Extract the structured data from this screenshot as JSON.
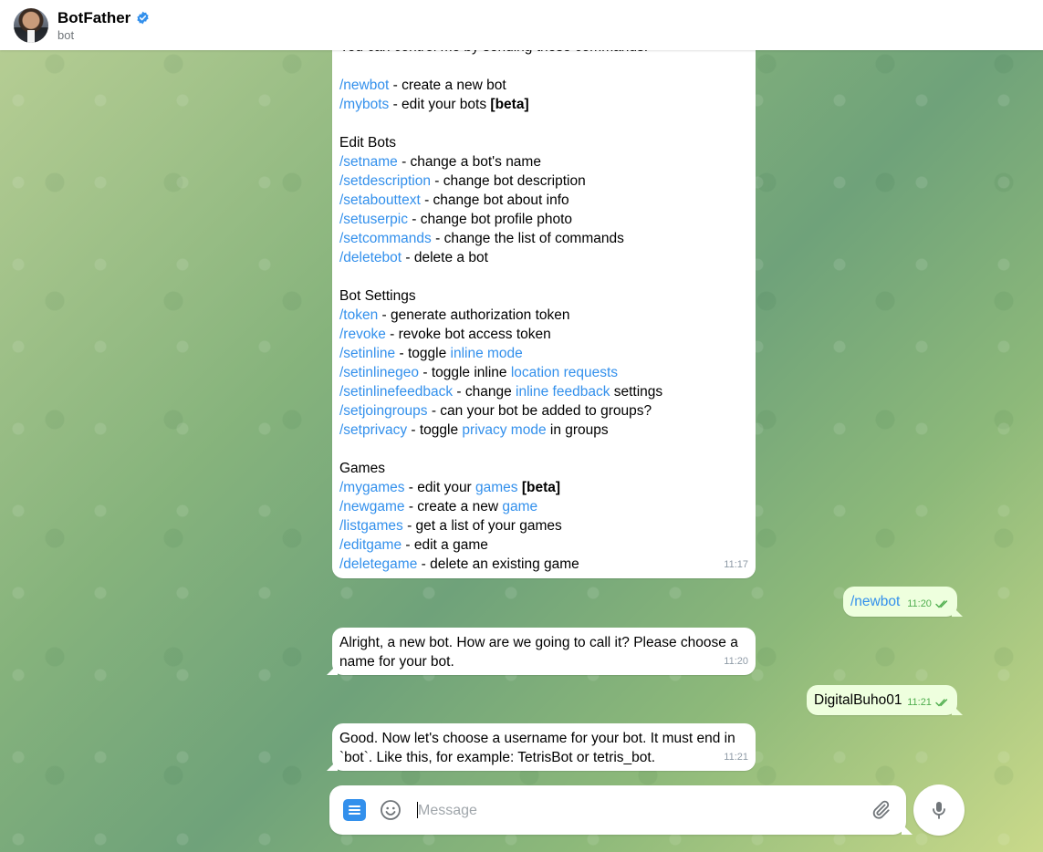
{
  "header": {
    "title": "BotFather",
    "subtitle": "bot"
  },
  "messages": {
    "commands_partial_top": "You can control me by sending these commands:",
    "commands": [
      {
        "cmd": "/newbot",
        "text": " - create a new bot"
      },
      {
        "cmd": "/mybots",
        "text": " - edit your bots ",
        "bold": "[beta]"
      }
    ],
    "edit_bots_heading": "Edit Bots",
    "edit_bots": [
      {
        "cmd": "/setname",
        "text": " - change a bot's name"
      },
      {
        "cmd": "/setdescription",
        "text": " - change bot description"
      },
      {
        "cmd": "/setabouttext",
        "text": " - change bot about info"
      },
      {
        "cmd": "/setuserpic",
        "text": " - change bot profile photo"
      },
      {
        "cmd": "/setcommands",
        "text": " - change the list of commands"
      },
      {
        "cmd": "/deletebot",
        "text": " - delete a bot"
      }
    ],
    "bot_settings_heading": "Bot Settings",
    "bot_settings": [
      {
        "cmd": "/token",
        "text": " - generate authorization token"
      },
      {
        "cmd": "/revoke",
        "text": " - revoke bot access token"
      },
      {
        "cmd": "/setinline",
        "text": " - toggle ",
        "link": "inline mode",
        "after": ""
      },
      {
        "cmd": "/setinlinegeo",
        "text": " - toggle inline ",
        "link": "location requests",
        "after": ""
      },
      {
        "cmd": "/setinlinefeedback",
        "text": " - change ",
        "link": "inline feedback",
        "after": " settings"
      },
      {
        "cmd": "/setjoingroups",
        "text": " - can your bot be added to groups?"
      },
      {
        "cmd": "/setprivacy",
        "text": " - toggle ",
        "link": "privacy mode",
        "after": " in groups"
      }
    ],
    "games_heading": "Games",
    "games": [
      {
        "cmd": "/mygames",
        "text": " - edit your ",
        "link": "games",
        "after": " ",
        "bold": "[beta]"
      },
      {
        "cmd": "/newgame",
        "text": " - create a new ",
        "link": "game",
        "after": ""
      },
      {
        "cmd": "/listgames",
        "text": " - get a list of your games"
      },
      {
        "cmd": "/editgame",
        "text": " - edit a game"
      },
      {
        "cmd": "/deletegame",
        "text": " - delete an existing game"
      }
    ],
    "commands_time": "11:17",
    "out1_text": "/newbot",
    "out1_time": "11:20",
    "in2_text": "Alright, a new bot. How are we going to call it? Please choose a name for your bot.",
    "in2_time": "11:20",
    "out2_text": "DigitalBuho01",
    "out2_time": "11:21",
    "in3_text": "Good. Now let's choose a username for your bot. It must end in `bot`. Like this, for example: TetrisBot or tetris_bot.",
    "in3_time": "11:21"
  },
  "composer": {
    "placeholder": "Message"
  },
  "icons": {
    "verified": "verified-badge-icon",
    "menu": "bot-menu-icon",
    "emoji": "emoji-icon",
    "attach": "paperclip-icon",
    "mic": "microphone-icon",
    "read_checks": "double-check-icon"
  },
  "colors": {
    "accent": "#3390ec",
    "outgoing_bubble": "#eeffde",
    "outgoing_time": "#4fae4e"
  }
}
